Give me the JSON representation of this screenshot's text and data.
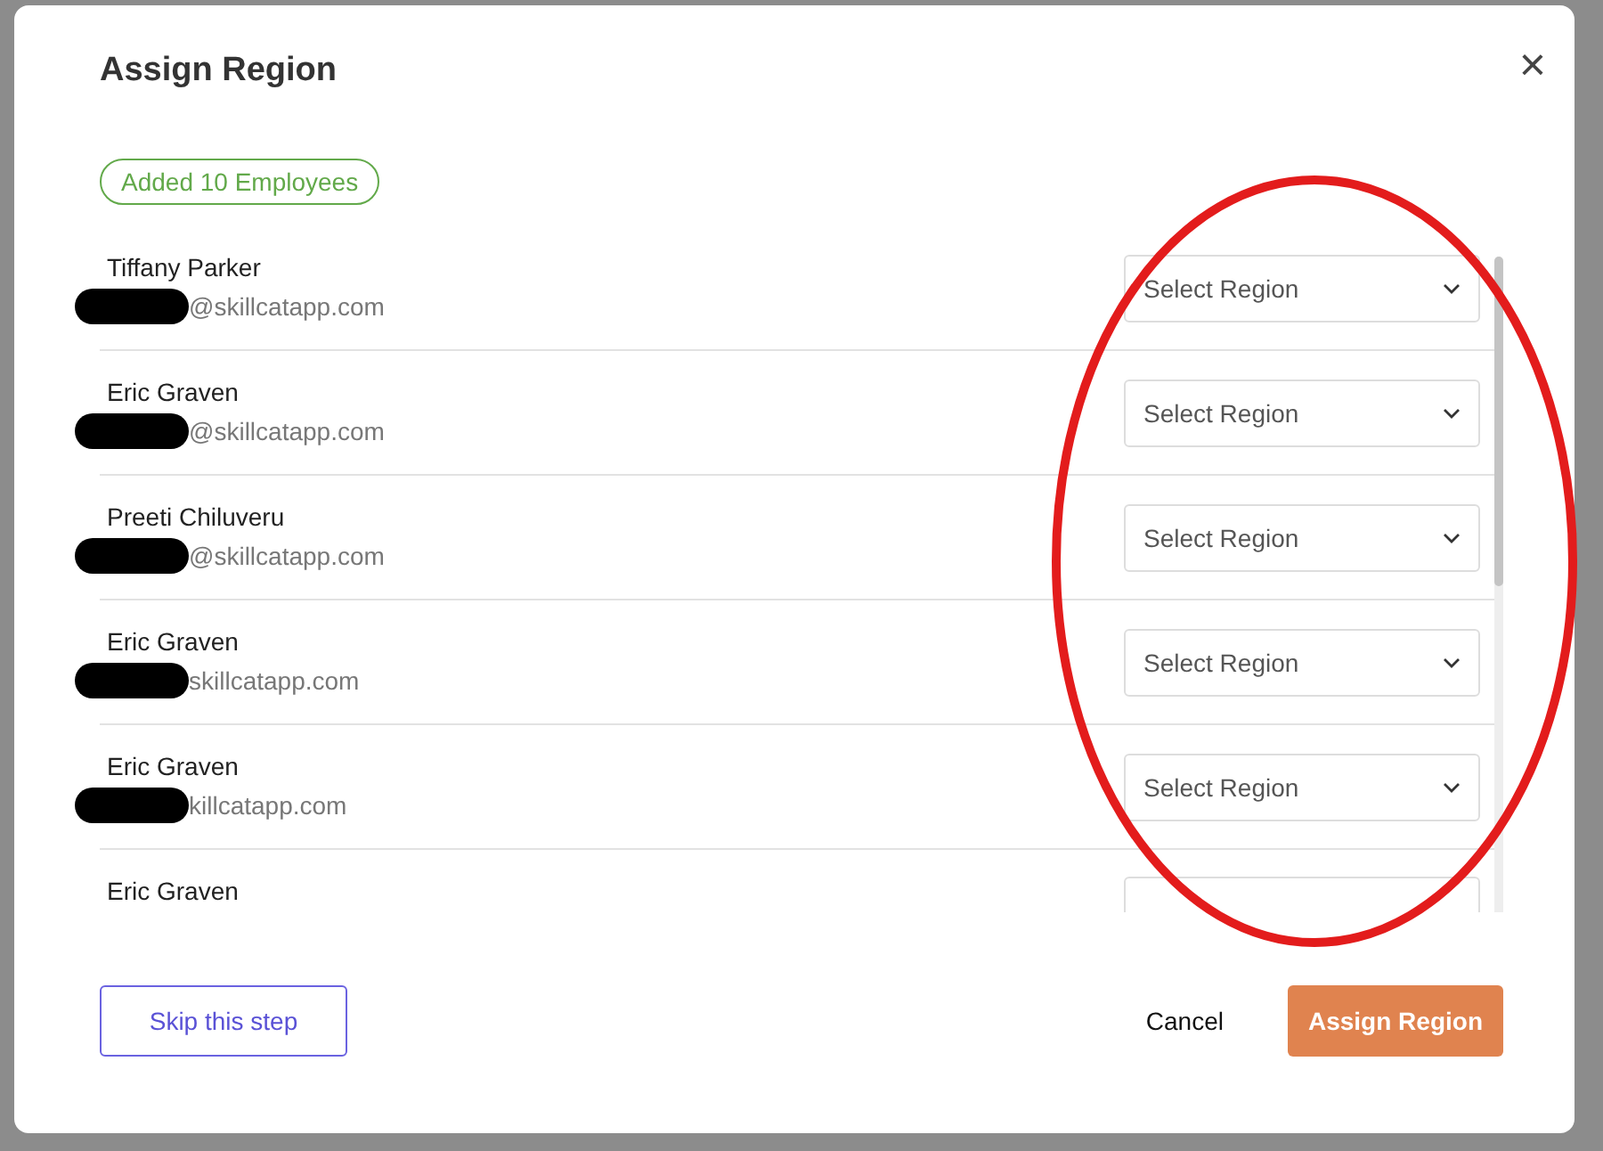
{
  "dialog": {
    "title": "Assign Region",
    "close_label": "×",
    "badge": "Added 10 Employees"
  },
  "employees": [
    {
      "name": "Tiffany Parker",
      "email": "@skillcatapp.com",
      "select_placeholder": "Select Region"
    },
    {
      "name": "Eric Graven",
      "email": "@skillcatapp.com",
      "select_placeholder": "Select Region"
    },
    {
      "name": "Preeti Chiluveru",
      "email": "@skillcatapp.com",
      "select_placeholder": "Select Region"
    },
    {
      "name": "Eric Graven",
      "email": "skillcatapp.com",
      "select_placeholder": "Select Region"
    },
    {
      "name": "Eric Graven",
      "email": "killcatapp.com",
      "select_placeholder": "Select Region"
    },
    {
      "name": "Eric Graven"
    }
  ],
  "footer": {
    "skip": "Skip this step",
    "cancel": "Cancel",
    "submit": "Assign Region"
  }
}
